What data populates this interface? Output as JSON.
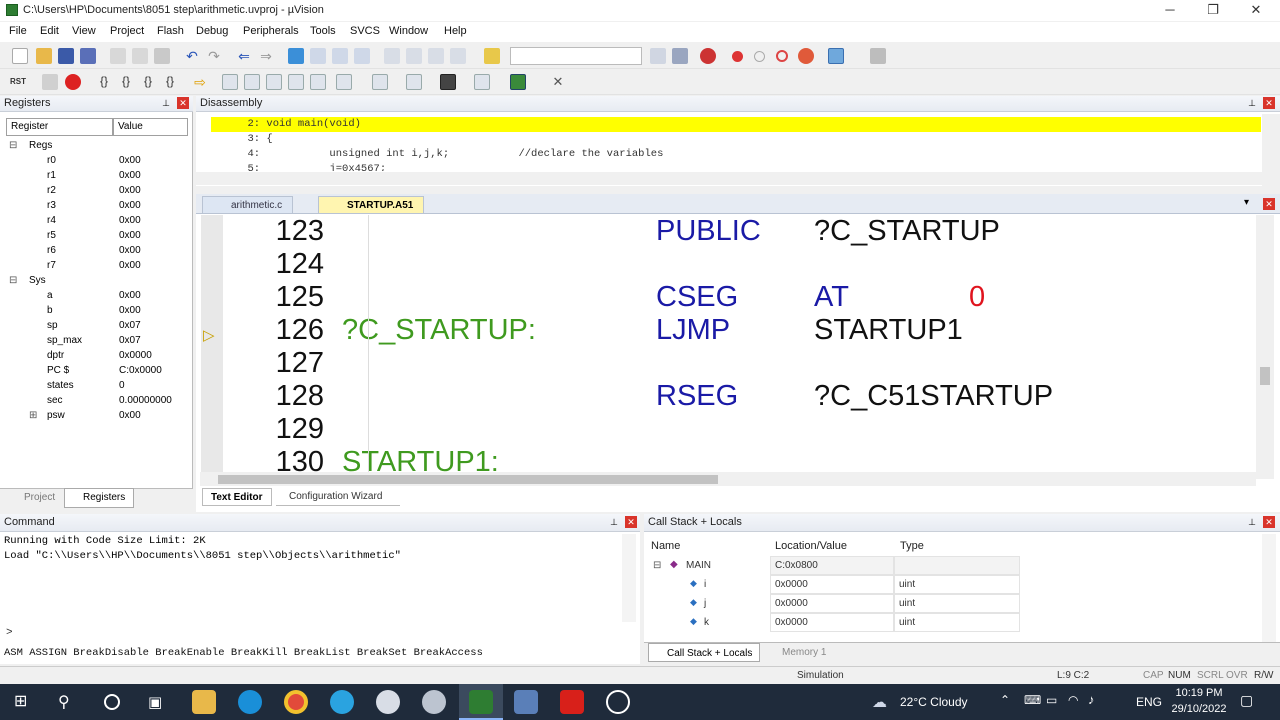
{
  "window": {
    "title": "C:\\Users\\HP\\Documents\\8051 step\\arithmetic.uvproj - µVision",
    "controls": [
      "─",
      "❐",
      "✕"
    ]
  },
  "menu": [
    "File",
    "Edit",
    "View",
    "Project",
    "Flash",
    "Debug",
    "Peripherals",
    "Tools",
    "SVCS",
    "Window",
    "Help"
  ],
  "toolbar": {
    "rst_label": "RST"
  },
  "registers": {
    "title": "Registers",
    "col_register": "Register",
    "col_value": "Value",
    "regs_group": "Regs",
    "regs": [
      {
        "name": "r0",
        "value": "0x00"
      },
      {
        "name": "r1",
        "value": "0x00"
      },
      {
        "name": "r2",
        "value": "0x00"
      },
      {
        "name": "r3",
        "value": "0x00"
      },
      {
        "name": "r4",
        "value": "0x00"
      },
      {
        "name": "r5",
        "value": "0x00"
      },
      {
        "name": "r6",
        "value": "0x00"
      },
      {
        "name": "r7",
        "value": "0x00"
      }
    ],
    "sys_group": "Sys",
    "sys": [
      {
        "name": "a",
        "value": "0x00"
      },
      {
        "name": "b",
        "value": "0x00"
      },
      {
        "name": "sp",
        "value": "0x07"
      },
      {
        "name": "sp_max",
        "value": "0x07"
      },
      {
        "name": "dptr",
        "value": "0x0000"
      },
      {
        "name": "PC  $",
        "value": "C:0x0000"
      },
      {
        "name": "states",
        "value": "0"
      },
      {
        "name": "sec",
        "value": "0.00000000"
      },
      {
        "name": "psw",
        "value": "0x00"
      }
    ],
    "tab_project": "Project",
    "tab_registers": "Registers"
  },
  "disassembly": {
    "title": "Disassembly",
    "lines": [
      "     2: void main(void)",
      "     3: {",
      "     4:           unsigned int i,j,k;           //declare the variables",
      "     5:           j=0x4567;"
    ]
  },
  "editor": {
    "tabs": [
      "arithmetic.c",
      "STARTUP.A51"
    ],
    "lines": [
      {
        "num": "123",
        "label": "",
        "op": "PUBLIC",
        "arg": "?C_STARTUP",
        "extra": ""
      },
      {
        "num": "124",
        "label": "",
        "op": "",
        "arg": "",
        "extra": ""
      },
      {
        "num": "125",
        "label": "",
        "op": "CSEG",
        "arg": "AT",
        "extra": "0"
      },
      {
        "num": "126",
        "label": "?C_STARTUP:",
        "op": "LJMP",
        "arg": "STARTUP1",
        "extra": ""
      },
      {
        "num": "127",
        "label": "",
        "op": "",
        "arg": "",
        "extra": ""
      },
      {
        "num": "128",
        "label": "",
        "op": "RSEG",
        "arg": "?C_C51STARTUP",
        "extra": ""
      },
      {
        "num": "129",
        "label": "",
        "op": "",
        "arg": "",
        "extra": ""
      },
      {
        "num": "130",
        "label": "STARTUP1:",
        "op": "",
        "arg": "",
        "extra": ""
      }
    ],
    "bottom_tabs": [
      "Text Editor",
      "Configuration Wizard"
    ]
  },
  "command": {
    "title": "Command",
    "output": [
      "Running with Code Size Limit: 2K",
      "Load \"C:\\\\Users\\\\HP\\\\Documents\\\\8051 step\\\\Objects\\\\arithmetic\""
    ],
    "prompt": ">",
    "hints": "ASM ASSIGN BreakDisable BreakEnable BreakKill BreakList BreakSet BreakAccess"
  },
  "callstack": {
    "title": "Call Stack + Locals",
    "col_name": "Name",
    "col_location": "Location/Value",
    "col_type": "Type",
    "rows": [
      {
        "name": "MAIN",
        "location": "C:0x0800",
        "type": ""
      },
      {
        "name": "i",
        "location": "0x0000",
        "type": "uint"
      },
      {
        "name": "j",
        "location": "0x0000",
        "type": "uint"
      },
      {
        "name": "k",
        "location": "0x0000",
        "type": "uint"
      }
    ],
    "tab_callstack": "Call Stack + Locals",
    "tab_memory": "Memory 1"
  },
  "status": {
    "mode": "Simulation",
    "position": "L:9 C:2",
    "flags": [
      "CAP",
      "NUM",
      "SCRL",
      "OVR",
      "R/W"
    ]
  },
  "taskbar": {
    "weather": "22°C  Cloudy",
    "lang": "ENG",
    "time": "10:19 PM",
    "date": "29/10/2022"
  }
}
